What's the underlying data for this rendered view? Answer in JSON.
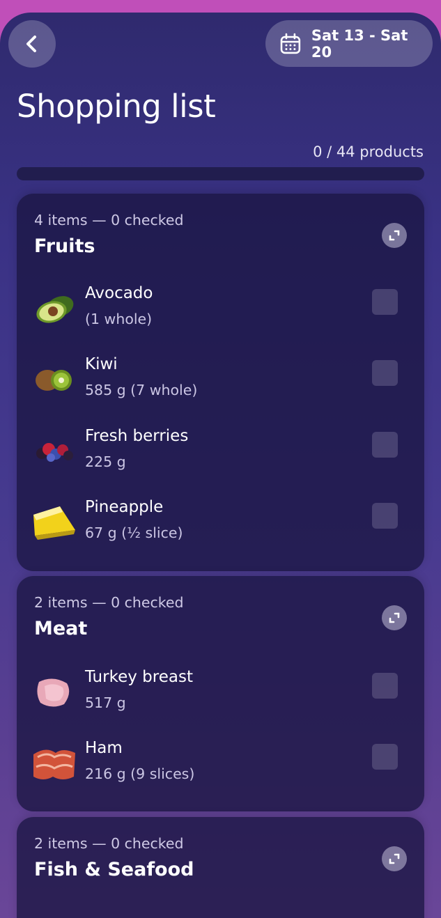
{
  "header": {
    "date_range": "Sat 13 - Sat 20"
  },
  "title": "Shopping list",
  "progress": {
    "text": "0 / 44  products",
    "checked": 0,
    "total": 44
  },
  "groups": [
    {
      "meta": "4 items — 0 checked",
      "title": "Fruits",
      "items": [
        {
          "name": "Avocado",
          "qty": "(1 whole)",
          "icon": "avocado-icon",
          "checked": false
        },
        {
          "name": "Kiwi",
          "qty": "585 g  (7 whole)",
          "icon": "kiwi-icon",
          "checked": false
        },
        {
          "name": "Fresh berries",
          "qty": "225 g",
          "icon": "berries-icon",
          "checked": false
        },
        {
          "name": "Pineapple",
          "qty": "67 g  (½ slice)",
          "icon": "pineapple-icon",
          "checked": false
        }
      ]
    },
    {
      "meta": "2 items — 0 checked",
      "title": "Meat",
      "items": [
        {
          "name": "Turkey breast",
          "qty": "517 g",
          "icon": "turkey-icon",
          "checked": false
        },
        {
          "name": "Ham",
          "qty": "216 g  (9 slices)",
          "icon": "ham-icon",
          "checked": false
        }
      ]
    },
    {
      "meta": "2 items — 0 checked",
      "title": "Fish & Seafood",
      "items": []
    }
  ],
  "colors": {
    "accent": "#8e7cf0",
    "background_top": "#c04fb9",
    "card": "#1b1642"
  }
}
